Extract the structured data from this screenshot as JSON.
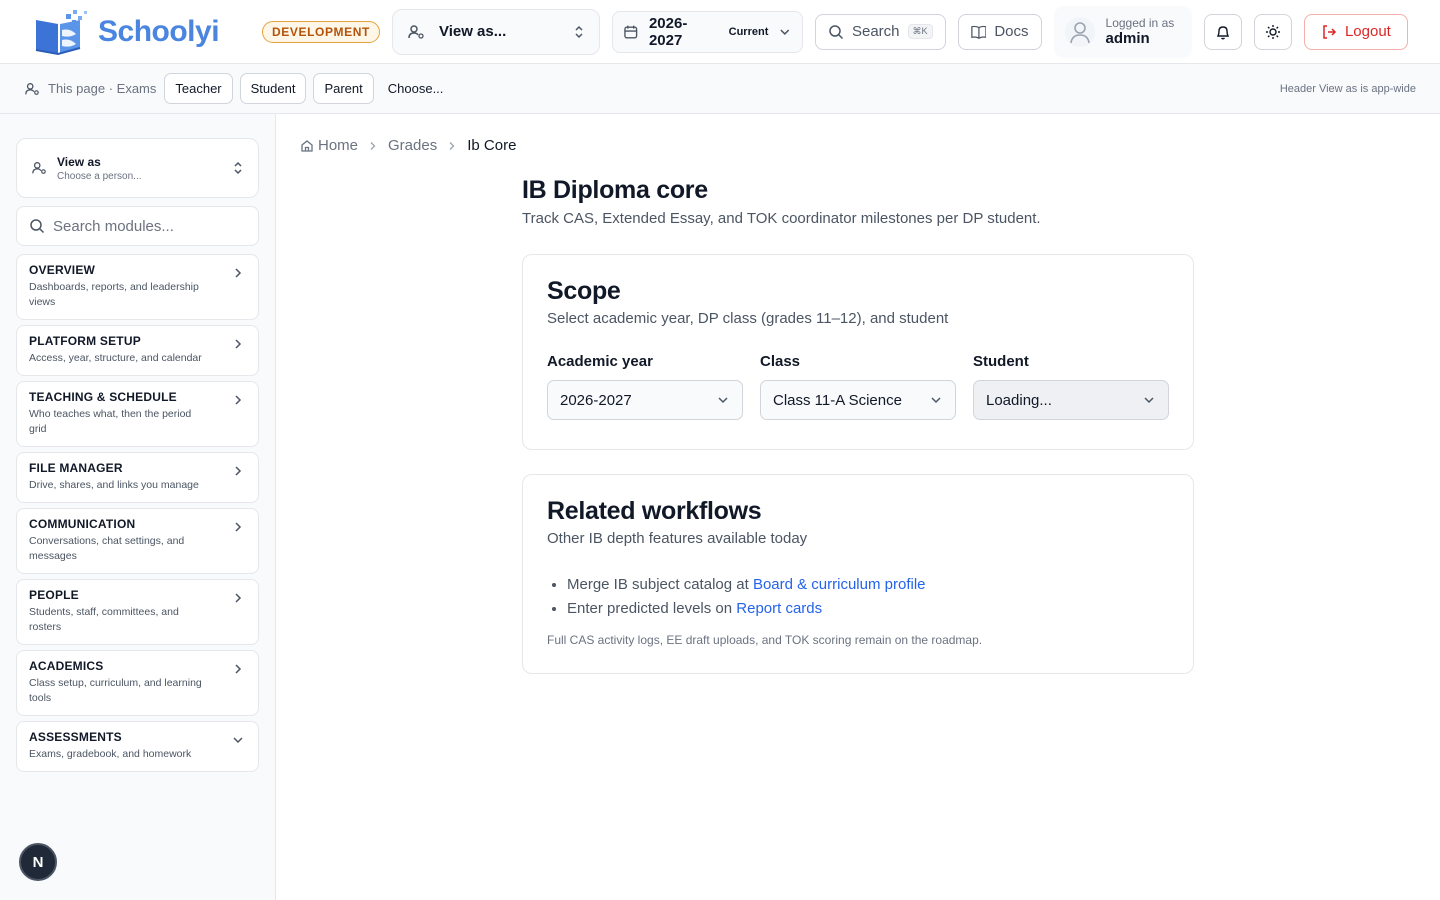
{
  "header": {
    "brand": "Schoolyi",
    "env_badge": "DEVELOPMENT",
    "view_as_label": "View as...",
    "year": "2026-2027",
    "year_tag": "Current",
    "search_label": "Search",
    "search_shortcut": "⌘K",
    "docs_label": "Docs",
    "user_caption": "Logged in as",
    "user_name": "admin",
    "logout_label": "Logout"
  },
  "subbar": {
    "page_label": "This page · Exams",
    "chips": [
      "Teacher",
      "Student",
      "Parent"
    ],
    "choose_label": "Choose...",
    "note": "Header View as is app-wide"
  },
  "sidebar": {
    "view_as_title": "View as",
    "view_as_sub": "Choose a person...",
    "search_placeholder": "Search modules...",
    "modules": [
      {
        "title": "OVERVIEW",
        "desc": "Dashboards, reports, and leadership views",
        "expanded": false
      },
      {
        "title": "PLATFORM SETUP",
        "desc": "Access, year, structure, and calendar",
        "expanded": false
      },
      {
        "title": "TEACHING & SCHEDULE",
        "desc": "Who teaches what, then the period grid",
        "expanded": false
      },
      {
        "title": "FILE MANAGER",
        "desc": "Drive, shares, and links you manage",
        "expanded": false
      },
      {
        "title": "COMMUNICATION",
        "desc": "Conversations, chat settings, and messages",
        "expanded": false
      },
      {
        "title": "PEOPLE",
        "desc": "Students, staff, committees, and rosters",
        "expanded": false
      },
      {
        "title": "ACADEMICS",
        "desc": "Class setup, curriculum, and learning tools",
        "expanded": false
      },
      {
        "title": "ASSESSMENTS",
        "desc": "Exams, gradebook, and homework",
        "expanded": true
      }
    ],
    "dev_button": "N"
  },
  "breadcrumb": {
    "home": "Home",
    "section": "Grades",
    "current": "Ib Core"
  },
  "main": {
    "title": "IB Diploma core",
    "description": "Track CAS, Extended Essay, and TOK coordinator milestones per DP student.",
    "scope": {
      "title": "Scope",
      "subtitle": "Select academic year, DP class (grades 11–12), and student",
      "fields": {
        "year": {
          "label": "Academic year",
          "value": "2026-2027"
        },
        "class": {
          "label": "Class",
          "value": "Class 11-A Science"
        },
        "student": {
          "label": "Student",
          "value": "Loading..."
        }
      }
    },
    "related": {
      "title": "Related workflows",
      "subtitle": "Other IB depth features available today",
      "item1_prefix": "Merge IB subject catalog at ",
      "item1_link": "Board & curriculum profile",
      "item2_prefix": "Enter predicted levels on ",
      "item2_link": "Report cards",
      "note": "Full CAS activity logs, EE draft uploads, and TOK scoring remain on the roadmap."
    }
  },
  "colors": {
    "brand": "#4a86e0",
    "link": "#2563eb",
    "danger": "#dc2626",
    "badge_border": "#e6a23c"
  }
}
